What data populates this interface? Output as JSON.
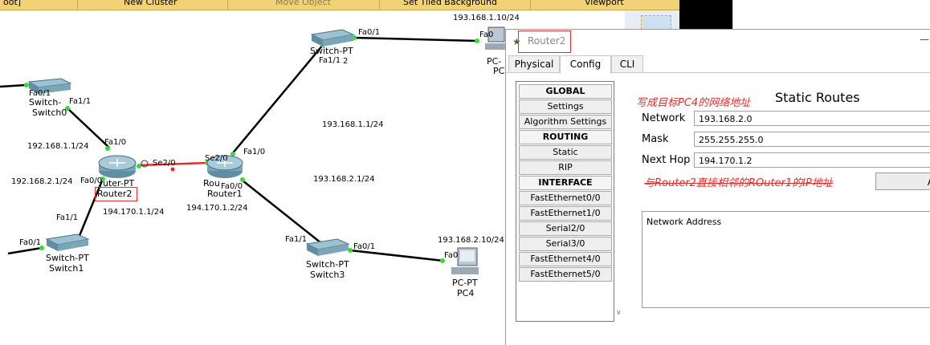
{
  "toolbar": {
    "items": [
      "oot]",
      "New Cluster",
      "Move Object",
      "Set Tiled Background",
      "Viewport"
    ]
  },
  "colors": {
    "link": "#000000",
    "serial_link": "#e0302b",
    "port_up": "#33dd33",
    "highlight": "#e0302b"
  },
  "topology": {
    "devices": {
      "switch_top": {
        "name": "Switch-PT",
        "port": "Fa1/1",
        "port_suffix": "2"
      },
      "switch0": {
        "type": "Switch-",
        "name": "Switch0"
      },
      "switch1": {
        "type": "Switch-PT",
        "name": "Switch1"
      },
      "switch3": {
        "type": "Switch-PT",
        "name": "Switch3"
      },
      "router2": {
        "type": "uter-PT",
        "name": "Router2"
      },
      "router1": {
        "type": "Rou",
        "name": "Router1"
      },
      "pc_top": {
        "type": "PC-",
        "name": "PC"
      },
      "pc4": {
        "type": "PC-PT",
        "name": "PC4"
      }
    },
    "ports": {
      "fa0_1_top": "Fa0/1",
      "fa0_top_pc": "Fa0",
      "fa0_1_sw0": "Fa0/1",
      "fa1_1_sw0": "Fa1/1",
      "fa1_0_r2": "Fa1/0",
      "se2_0_r2": "Se2/0",
      "se2_0_r1": "Se2/0",
      "fa1_0_r1": "Fa1/0",
      "fa0_0_r2": "Fa0/0",
      "fa0_0_r1": "Fa0/0",
      "fa1_1_sw1": "Fa1/1",
      "fa0_1_sw1": "Fa0/1",
      "fa1_1_sw3": "Fa1/1",
      "fa0_1_sw3": "Fa0/1",
      "fa0_pc4": "Fa0"
    },
    "ips": {
      "ip_pc_top": "193.168.1.10/24",
      "ip_r2_fa1": "192.168.1.1/24",
      "ip_r2_fa0": "192.168.2.1/24",
      "ip_r2_se": "194.170.1.1/24",
      "ip_r1_se": "194.170.1.2/24",
      "ip_r1_fa1": "193.168.1.1/24",
      "ip_r1_fa0": "193.168.2.1/24",
      "ip_pc4": "193.168.2.10/24"
    }
  },
  "window": {
    "title": "Router2",
    "tabs": [
      "Physical",
      "Config",
      "CLI"
    ],
    "active_tab": "Config",
    "sidebar": [
      {
        "label": "GLOBAL",
        "header": true
      },
      {
        "label": "Settings",
        "header": false
      },
      {
        "label": "Algorithm Settings",
        "header": false
      },
      {
        "label": "ROUTING",
        "header": true
      },
      {
        "label": "Static",
        "header": false
      },
      {
        "label": "RIP",
        "header": false
      },
      {
        "label": "INTERFACE",
        "header": true
      },
      {
        "label": "FastEthernet0/0",
        "header": false
      },
      {
        "label": "FastEthernet1/0",
        "header": false
      },
      {
        "label": "Serial2/0",
        "header": false
      },
      {
        "label": "Serial3/0",
        "header": false
      },
      {
        "label": "FastEthernet4/0",
        "header": false
      },
      {
        "label": "FastEthernet5/0",
        "header": false
      }
    ],
    "annotation_top": "写成目标PC4的网络地址",
    "annotation_bottom": "与Router2直接相邻的ROuter1的IP地址",
    "section_title": "Static Routes",
    "fields": {
      "network_label": "Network",
      "network_value": "193.168.2.0",
      "mask_label": "Mask",
      "mask_value": "255.255.255.0",
      "nexthop_label": "Next Hop",
      "nexthop_value": "194.170.1.2"
    },
    "add_button": "A",
    "network_address_header": "Network Address"
  }
}
